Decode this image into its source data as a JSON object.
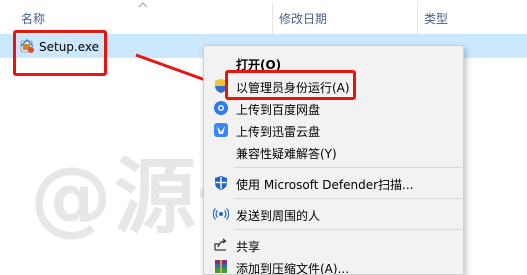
{
  "explorer": {
    "columns": {
      "name": "名称",
      "date": "修改日期",
      "type": "类型"
    },
    "file": {
      "name": "Setup.exe",
      "date_partial": "",
      "type_partial": ""
    }
  },
  "watermark": {
    "text": "@源一风"
  },
  "context_menu": {
    "items": [
      {
        "label": "打开(O)",
        "icon": "none"
      },
      {
        "label": "以管理员身份运行(A)",
        "icon": "uac-shield-icon"
      },
      {
        "label": "上传到百度网盘",
        "icon": "baidu-netdisk-icon"
      },
      {
        "label": "上传到迅雷云盘",
        "icon": "thunder-cloud-icon"
      },
      {
        "label": "兼容性疑难解答(Y)",
        "icon": "none"
      },
      {
        "label": "使用 Microsoft Defender扫描...",
        "icon": "defender-shield-icon"
      },
      {
        "label": "发送到周围的人",
        "icon": "nearby-share-icon"
      },
      {
        "label": "共享",
        "icon": "share-icon"
      },
      {
        "label": "添加到压缩文件(A)...",
        "icon": "winrar-icon"
      }
    ]
  },
  "colors": {
    "selection": "#cce8ff",
    "highlight_red": "#e8150f",
    "menu_bg": "#f2f2f2"
  }
}
